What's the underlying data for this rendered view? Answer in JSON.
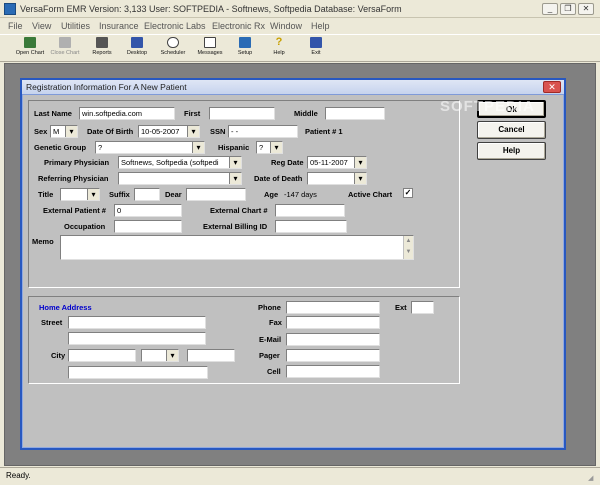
{
  "window": {
    "title": "VersaForm EMR       Version: 3,133   User: SOFTPEDIA - Softnews,  Softpedia  Database: VersaForm"
  },
  "menu": [
    "File",
    "View",
    "Utilities",
    "Insurance",
    "Electronic Labs",
    "Electronic Rx",
    "Window",
    "Help"
  ],
  "toolbar": [
    {
      "label": "Open Chart",
      "icon": "open-chart-icon",
      "color": "#3a7a3a"
    },
    {
      "label": "Close Chart",
      "icon": "close-chart-icon",
      "color": "#9a9a9a"
    },
    {
      "label": "Reports",
      "icon": "printer-icon",
      "color": "#555555"
    },
    {
      "label": "Desktop",
      "icon": "desktop-icon",
      "color": "#3355aa"
    },
    {
      "label": "Scheduler",
      "icon": "clock-icon",
      "color": "#666666"
    },
    {
      "label": "Messages",
      "icon": "envelope-icon",
      "color": "#444444"
    },
    {
      "label": "Setup",
      "icon": "setup-icon",
      "color": "#2a6bb5"
    },
    {
      "label": "Help",
      "icon": "question-icon",
      "color": "#c8a000"
    },
    {
      "label": "Exit",
      "icon": "exit-icon",
      "color": "#3355aa"
    }
  ],
  "dialog": {
    "title": "Registration Information For A New Patient",
    "buttons": {
      "ok": "Ok",
      "cancel": "Cancel",
      "help": "Help"
    }
  },
  "patient": {
    "last_name_label": "Last Name",
    "last_name": "win.softpedia.com",
    "first_label": "First",
    "first": "",
    "middle_label": "Middle",
    "middle": "",
    "sex_label": "Sex",
    "sex": "M",
    "dob_label": "Date Of Birth",
    "dob": "10-05-2007",
    "ssn_label": "SSN",
    "ssn": "  -  -",
    "patient_no": "Patient # 1",
    "genetic_group_label": "Genetic Group",
    "genetic_group": "?",
    "hispanic_label": "Hispanic",
    "hispanic": "?",
    "primary_physician_label": "Primary Physician",
    "primary_physician": "Softnews,  Softpedia (softpedi",
    "reg_date_label": "Reg Date",
    "reg_date": "05-11-2007",
    "referring_physician_label": "Referring Physician",
    "referring_physician": "",
    "date_of_death_label": "Date of Death",
    "date_of_death": "",
    "title_label": "Title",
    "title": "",
    "suffix_label": "Suffix",
    "suffix": "",
    "dear_label": "Dear",
    "dear": "",
    "age_label": "Age",
    "age": "-147 days",
    "active_chart_label": "Active Chart",
    "active_chart_checked": true,
    "external_patient_label": "External Patient #",
    "external_patient": "0",
    "external_chart_label": "External Chart #",
    "external_chart": "",
    "occupation_label": "Occupation",
    "occupation": "",
    "external_billing_label": "External Billing ID",
    "external_billing": "",
    "memo_label": "Memo",
    "memo": ""
  },
  "address": {
    "heading": "Home Address",
    "street_label": "Street",
    "street": "",
    "street2": "",
    "city_label": "City",
    "city": "",
    "state": "",
    "zip": "",
    "extra_line": "",
    "phone_label": "Phone",
    "phone": "",
    "ext_label": "Ext",
    "ext": "",
    "fax_label": "Fax",
    "fax": "",
    "email_label": "E-Mail",
    "email": "",
    "pager_label": "Pager",
    "pager": "",
    "cell_label": "Cell",
    "cell": ""
  },
  "status": {
    "text": "Ready."
  },
  "watermark": "SOFTPEDIA"
}
